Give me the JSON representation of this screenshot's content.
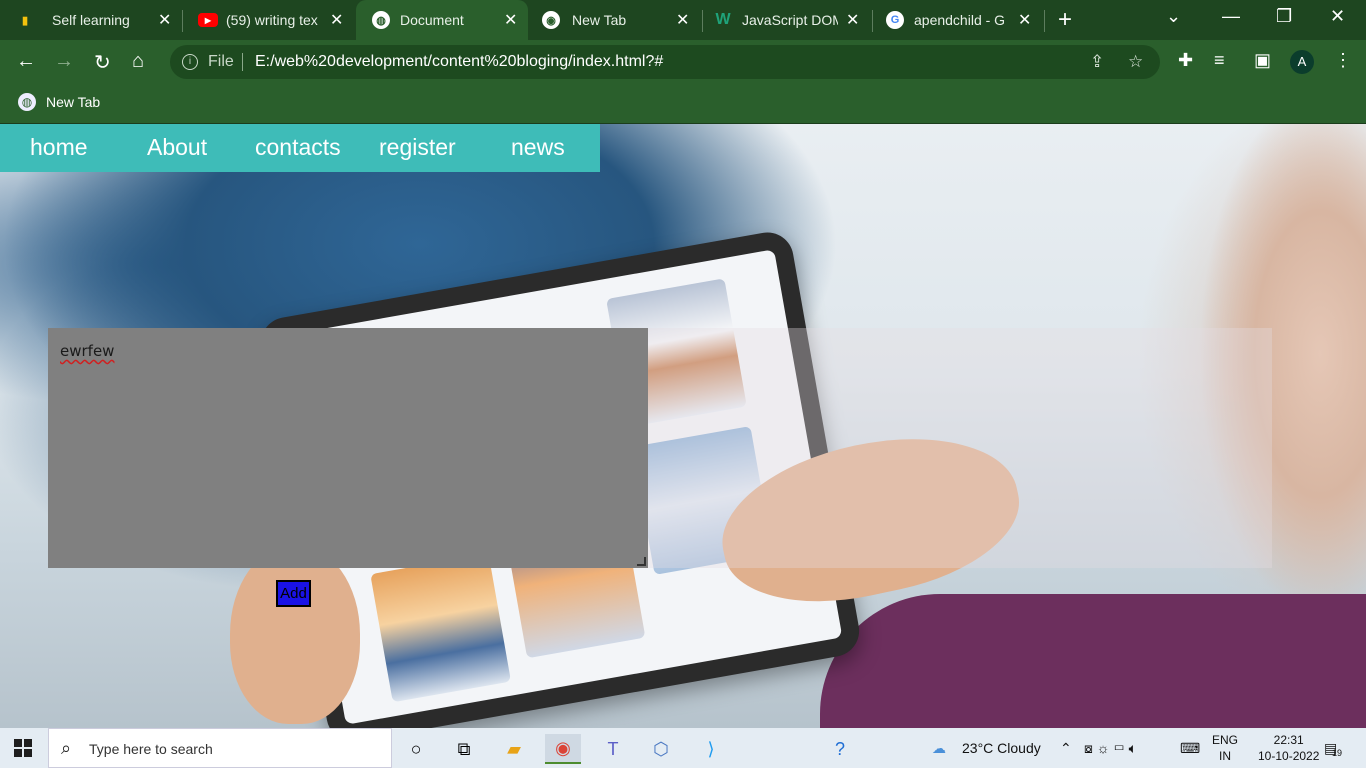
{
  "browser": {
    "tabs": [
      {
        "label": "Self learning",
        "icon": "bars-icon",
        "icon_color": "#f4c20d"
      },
      {
        "label": "(59) writing tex",
        "icon": "youtube-icon",
        "icon_color": "#ff0000"
      },
      {
        "label": "Document",
        "icon": "globe-icon",
        "icon_color": "#ffffff",
        "active": true
      },
      {
        "label": "New Tab",
        "icon": "chrome-icon",
        "icon_color": "#ffffff"
      },
      {
        "label": "JavaScript DOM",
        "icon": "w-icon",
        "icon_color": "#1fa37a"
      },
      {
        "label": "apendchild - G",
        "icon": "google-icon",
        "icon_color": "#4285f4"
      }
    ],
    "address": {
      "scheme_label": "File",
      "url": "E:/web%20development/content%20bloging/index.html?#"
    },
    "profile_initial": "A",
    "bookmarks": [
      {
        "label": "New Tab"
      }
    ]
  },
  "page": {
    "nav": [
      "home",
      "About",
      "contacts",
      "register",
      "news"
    ],
    "textarea_value": "ewrfew",
    "add_button_label": "Add",
    "colors": {
      "navbar": "#3ebcb8",
      "textarea": "#808080",
      "button": "#1a12e6"
    }
  },
  "taskbar": {
    "search_placeholder": "Type here to search",
    "weather": "23°C  Cloudy",
    "language": [
      "ENG",
      "IN"
    ],
    "time": "22:31",
    "date": "10-10-2022",
    "notification_count": "19"
  }
}
